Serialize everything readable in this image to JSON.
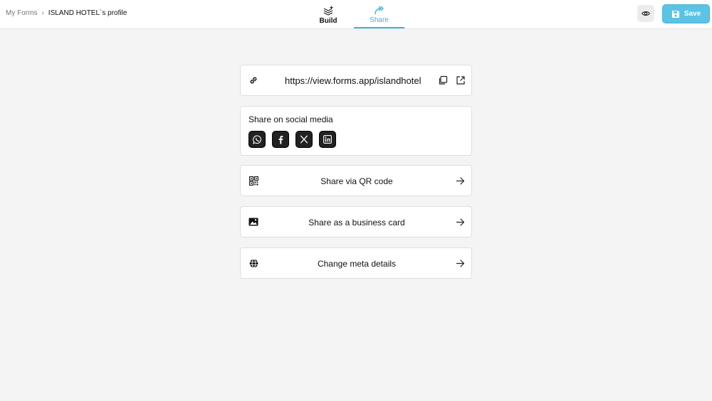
{
  "breadcrumb": {
    "parent": "My Forms",
    "separator": "›",
    "current": "ISLAND HOTEL`s profile"
  },
  "tabs": {
    "build": {
      "label": "Build",
      "icon": "layers-plus-icon"
    },
    "share": {
      "label": "Share",
      "icon": "share-arrows-icon",
      "active": true
    }
  },
  "header": {
    "save_label": "Save",
    "accent": "#3fb2d6",
    "save_color": "#5cc3e3"
  },
  "share_link": {
    "url": "https://view.forms.app/islandhotel",
    "icons": [
      "link-icon",
      "copy-icon",
      "external-link-icon"
    ]
  },
  "social": {
    "title": "Share on social media",
    "networks": [
      "whatsapp-icon",
      "facebook-icon",
      "x-icon",
      "linkedin-icon"
    ]
  },
  "options": {
    "qr": {
      "label": "Share via QR code",
      "icon": "qr-code-icon"
    },
    "business_card": {
      "label": "Share as a business card",
      "icon": "image-icon"
    },
    "meta": {
      "label": "Change meta details",
      "icon": "globe-icon"
    }
  }
}
